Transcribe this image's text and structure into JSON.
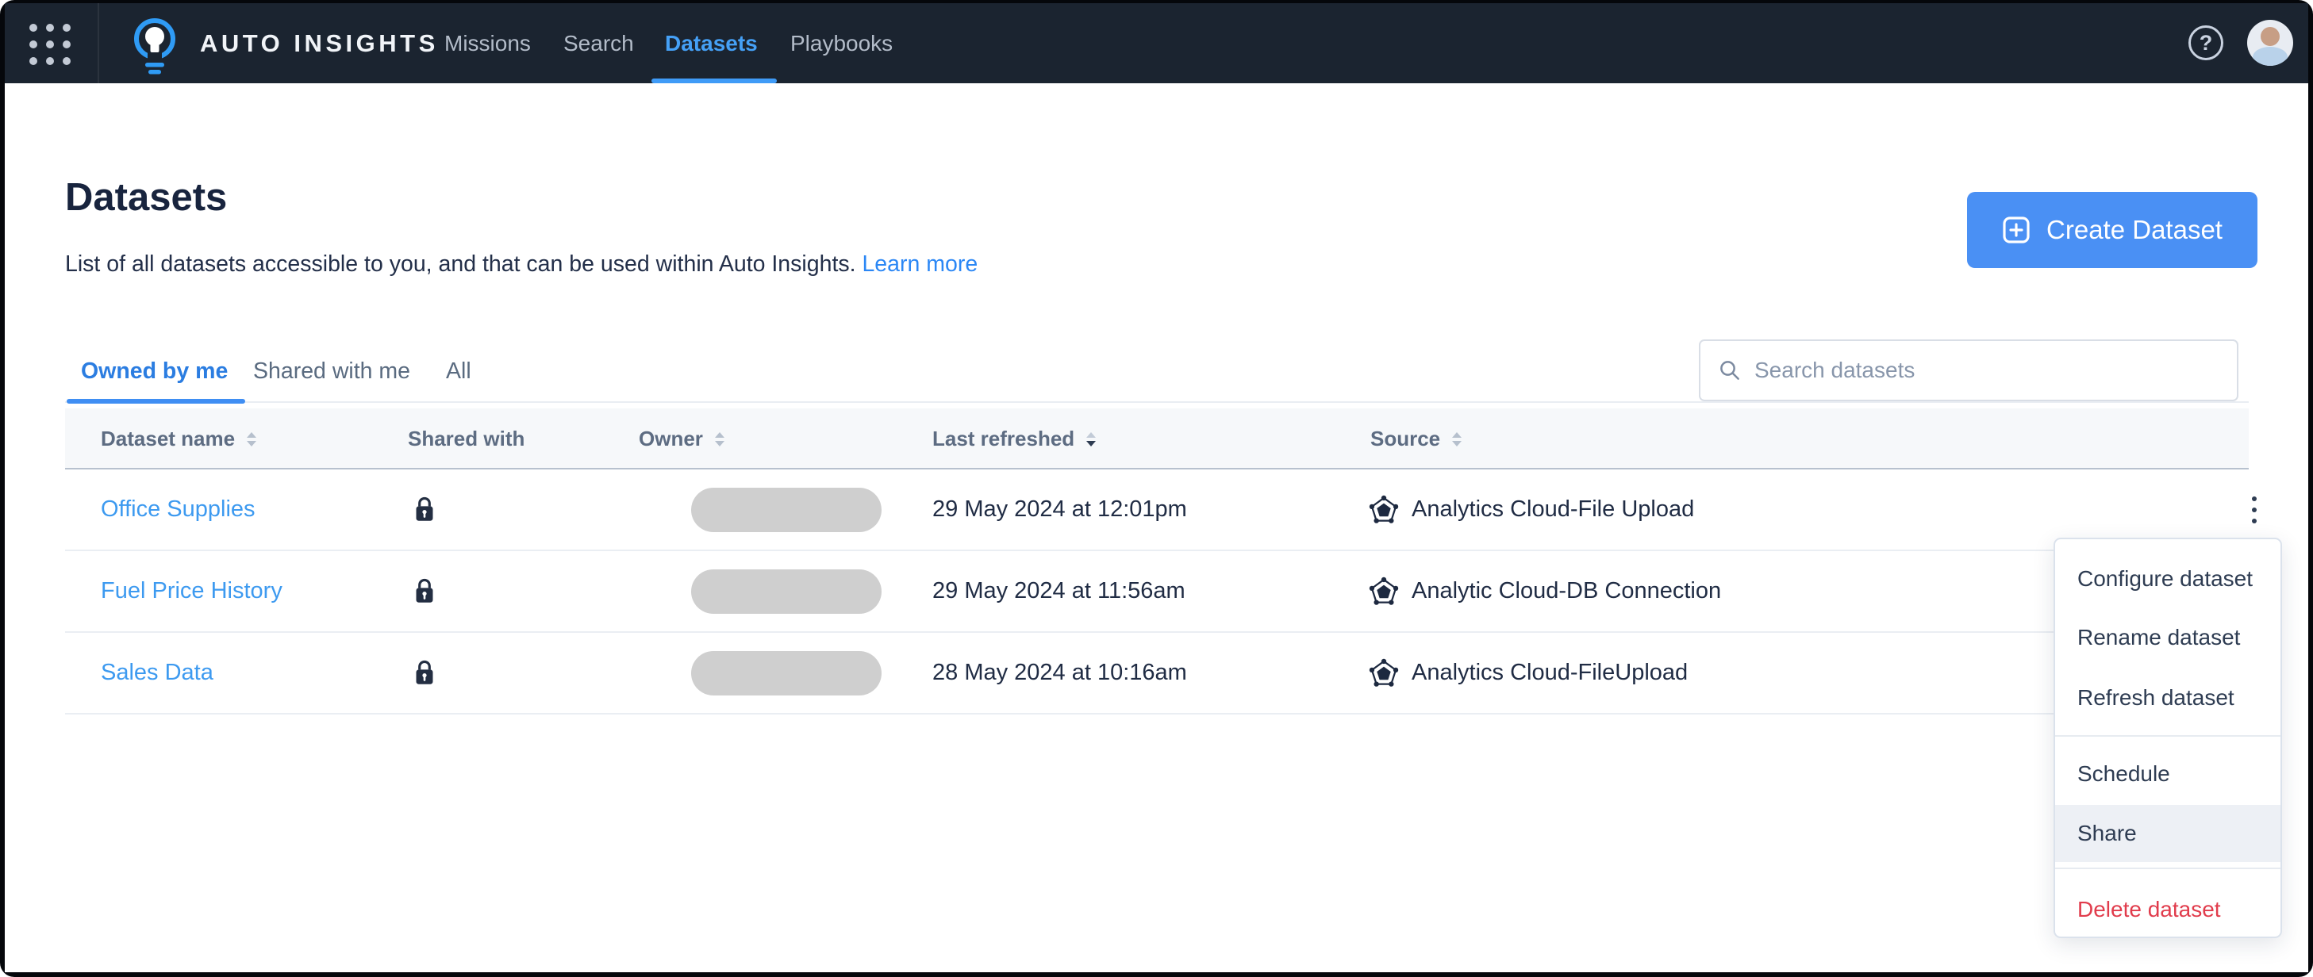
{
  "nav": {
    "brand": "AUTO INSIGHTS",
    "items": [
      {
        "label": "Missions",
        "active": false
      },
      {
        "label": "Search",
        "active": false
      },
      {
        "label": "Datasets",
        "active": true
      },
      {
        "label": "Playbooks",
        "active": false
      }
    ]
  },
  "icons": {
    "help_glyph": "?"
  },
  "page": {
    "title": "Datasets",
    "subtitle": "List of all datasets accessible to you, and that can be used within Auto Insights.",
    "learn_more": "Learn more",
    "create_label": "Create Dataset"
  },
  "tabs": [
    {
      "label": "Owned by me",
      "active": true
    },
    {
      "label": "Shared with me",
      "active": false
    },
    {
      "label": "All",
      "active": false
    }
  ],
  "search": {
    "placeholder": "Search datasets"
  },
  "table": {
    "columns": [
      {
        "label": "Dataset name",
        "sortable": true
      },
      {
        "label": "Shared with",
        "sortable": false
      },
      {
        "label": "Owner",
        "sortable": true
      },
      {
        "label": "Last refreshed",
        "sortable": true,
        "sorted": "desc"
      },
      {
        "label": "Source",
        "sortable": true
      }
    ],
    "rows": [
      {
        "name": "Office Supplies",
        "shared_with": "lock-icon",
        "owner_redacted": true,
        "last_refreshed": "29 May 2024 at 12:01pm",
        "source": "Analytics Cloud-File Upload"
      },
      {
        "name": "Fuel Price History",
        "shared_with": "lock-icon",
        "owner_redacted": true,
        "last_refreshed": "29 May 2024 at 11:56am",
        "source": "Analytic Cloud-DB Connection"
      },
      {
        "name": "Sales Data",
        "shared_with": "lock-icon",
        "owner_redacted": true,
        "last_refreshed": "28 May 2024 at 10:16am",
        "source": "Analytics Cloud-FileUpload"
      }
    ]
  },
  "menu": {
    "items": [
      {
        "label": "Configure dataset"
      },
      {
        "label": "Rename dataset"
      },
      {
        "label": "Refresh dataset"
      },
      {
        "label": "Schedule"
      },
      {
        "label": "Share",
        "highlighted": true
      },
      {
        "label": "Delete dataset",
        "danger": true
      }
    ]
  },
  "colors": {
    "nav_bg": "#1b2430",
    "accent_blue": "#3f9bf7",
    "link_blue": "#3d9af0",
    "delete_red": "#e13c4c",
    "header_bg": "#f6f8fa"
  }
}
